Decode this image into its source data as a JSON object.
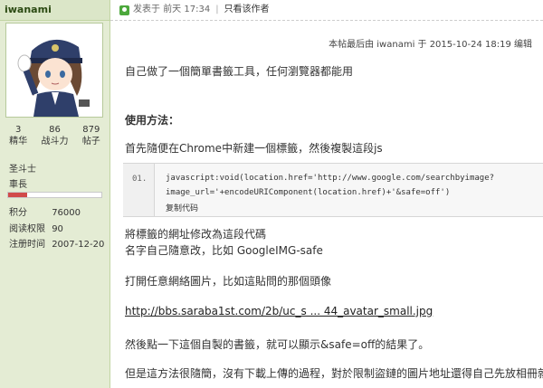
{
  "sidebar": {
    "username": "iwanami",
    "stats": [
      {
        "value": "3",
        "label": "精华"
      },
      {
        "value": "86",
        "label": "战斗力"
      },
      {
        "value": "879",
        "label": "帖子"
      }
    ],
    "rank": "圣斗士",
    "level": "車長",
    "progress_fraction": 0.2,
    "info": [
      {
        "key": "积分",
        "value": "76000"
      },
      {
        "key": "阅读权限",
        "value": "90"
      },
      {
        "key": "注册时间",
        "value": "2007-12-20"
      }
    ]
  },
  "post": {
    "posted_prefix": "发表于",
    "posted_time": "前天 17:34",
    "separator": "|",
    "author_only": "只看该作者",
    "edit_note": "本帖最后由 iwanami 于 2015-10-24 18:19 编辑",
    "lines": {
      "intro": "自己做了一個簡單書籤工具，任何瀏覽器都能用",
      "usage_heading": "使用方法：",
      "step1": "首先隨便在Chrome中新建一個標籤，然後複製這段js",
      "step2a": "將標籤的網址修改為這段代碼",
      "step2b": "名字自己隨意改，比如 GoogleIMG-safe",
      "step3": "打開任意網絡圖片，比如這貼問的那個頭像",
      "link": "http://bbs.saraba1st.com/2b/uc_s ... 44_avatar_small.jpg",
      "step4": "然後點一下這個自製的書籤，就可以顯示&safe=off的結果了。",
      "note": "但是這方法很隨簡，沒有下載上傳的過程，對於限制盜鏈的圖片地址還得自己先放相冊就是了.."
    },
    "code": {
      "line_number": "01.",
      "line1": "javascript:void(location.href='http://www.google.com/searchbyimage?",
      "line2": "image_url='+encodeURIComponent(location.href)+'&safe=off')",
      "copy_label": "复制代码"
    }
  },
  "colors": {
    "sidebar_bg": "#e4ecd4",
    "progress_fill": "#d14a4a",
    "online_icon": "#4ca83c"
  }
}
